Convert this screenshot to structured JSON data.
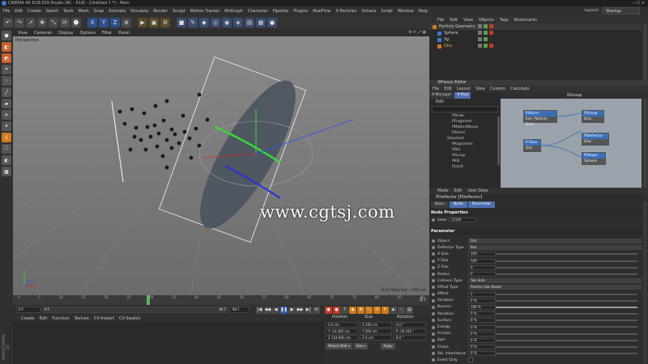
{
  "window": {
    "title": "CINEMA 4D R18.039 Studio (RC - R18) - [Untitled 1 *] - Main",
    "controls": "─ ☐ ✕"
  },
  "menubar": {
    "items": [
      "File",
      "Edit",
      "Create",
      "Select",
      "Tools",
      "Mesh",
      "Snap",
      "Animate",
      "Simulate",
      "Render",
      "Sculpt",
      "Motion Tracker",
      "MoGraph",
      "Character",
      "Pipeline",
      "Plugins",
      "RealFlow",
      "X-Particles",
      "Octane",
      "Script",
      "Window",
      "Help"
    ],
    "layout_label": "Layout:",
    "layout_value": "Startup"
  },
  "toolbar": {
    "icons": [
      "undo-icon",
      "redo-icon",
      "select-icon",
      "move-icon",
      "scale-icon",
      "rotate-icon",
      "recent-icon",
      "x-axis-icon",
      "y-axis-icon",
      "z-axis-icon",
      "coord-icon",
      "render-view-icon",
      "render-pv-icon",
      "render-settings-icon",
      "cube-icon",
      "pen-icon",
      "subdivision-icon",
      "array-icon",
      "nurbs-icon",
      "deformer-icon",
      "scene-icon",
      "camera-icon",
      "light-icon"
    ],
    "glyphs": [
      "↶",
      "↷",
      "➚",
      "✥",
      "⤡",
      "⟳",
      "⌚",
      "X",
      "Y",
      "Z",
      "⊕",
      "▶",
      "▣",
      "⚙",
      "■",
      "✎",
      "◆",
      "◎",
      "◉",
      "◈",
      "▤",
      "▦",
      "●"
    ]
  },
  "left_tools": {
    "icons": [
      "make-editable-icon",
      "model-mode-icon",
      "texture-mode-icon",
      "workplane-icon",
      "points-mode-icon",
      "edges-mode-icon",
      "polygons-mode-icon",
      "axis-mode-icon",
      "tweak-icon",
      "snap-icon",
      "locked-workplane-icon",
      "soft-select-icon",
      "quantize-icon"
    ],
    "glyphs": [
      "⬢",
      "◧",
      "◩",
      "⌗",
      "⁘",
      "╱",
      "▰",
      "✛",
      "⚹",
      "S",
      "⛶",
      "◐",
      "▩"
    ]
  },
  "viewport": {
    "menu": [
      "View",
      "Cameras",
      "Display",
      "Options",
      "Filter",
      "Panel"
    ],
    "view_icons": "✥ ⟳ ⤢ ▣",
    "label": "Perspective",
    "grid_spacing": "Grid Spacing : 100 cm",
    "watermark": "www.cgtsj.com"
  },
  "timeline": {
    "ticks": [
      "0",
      "5",
      "10",
      "15",
      "20",
      "25",
      "30",
      "35",
      "40",
      "45",
      "50",
      "55",
      "60",
      "65",
      "70",
      "75",
      "80",
      "85",
      "90"
    ],
    "end_frame": "32 F"
  },
  "transport": {
    "start": "0 F",
    "current": "0 F",
    "slider_value": "90 F",
    "end": "90 F",
    "buttons": [
      "|◀",
      "◀◀",
      "◀",
      "❚❚",
      "▶",
      "▶▶",
      "▶|",
      "⟲"
    ],
    "key_buttons": [
      "●",
      "●",
      "?",
      "◆",
      "✥",
      "⤡",
      "⟳",
      "P",
      "◈",
      "⁘",
      "▤"
    ]
  },
  "material_manager": {
    "menu": [
      "Create",
      "Edit",
      "Function",
      "Texture",
      "CV-Import",
      "CV-Swatch"
    ],
    "brand": "MAXON CINEMA 4D"
  },
  "coordinates": {
    "headers": [
      "Position",
      "Size",
      "Rotation"
    ],
    "rows": [
      [
        "X  0 cm",
        "X  200 cm",
        "H  0 °"
      ],
      [
        "Y  -12.405 cm",
        "Y  200 cm",
        "P  -36.192 °"
      ],
      [
        "Z  154.683 cm",
        "Z  0 cm",
        "B  0 °"
      ]
    ],
    "mode": "Object (Rel) ▾",
    "size_mode": "Size ▾",
    "apply": "Apply"
  },
  "object_manager": {
    "menu": [
      "File",
      "Edit",
      "View",
      "Objects",
      "Tags",
      "Bookmarks"
    ],
    "objects": [
      {
        "name": "Particle Geometry",
        "icon": "orange"
      },
      {
        "name": "Sphere",
        "icon": "blue"
      },
      {
        "name": "Xp",
        "icon": "blue"
      },
      {
        "name": "Disc",
        "icon": "orange"
      }
    ]
  },
  "xpresso": {
    "title": "XPresso Editor",
    "menu": [
      "File",
      "Edit",
      "Layout",
      "View",
      "Custom",
      "Calculate"
    ],
    "tabs": [
      "X-Manager",
      "X-Pool"
    ],
    "edit": "Edit",
    "tree": [
      "PDraw",
      "PFragment",
      "PMatterWaves",
      "PStorm",
      "Standard",
      "PAlignment",
      "PDie",
      "PGroup",
      "PKill",
      "PLimit"
    ],
    "graph_title": "XGroup",
    "nodes": [
      {
        "title": "PStorm",
        "port": "Ext. Particle Birth"
      },
      {
        "title": "PGroup",
        "port": "Disc"
      },
      {
        "title": "P Pass",
        "port": "Out"
      },
      {
        "title": "PDeflector",
        "port": "Disc"
      },
      {
        "title": "PShape",
        "port": "Sphere"
      }
    ]
  },
  "attributes": {
    "menu": [
      "Mode",
      "Edit",
      "User Data"
    ],
    "title": "PDeflector [PDeflector]",
    "tabs": [
      "Basic",
      "Node",
      "Parameter"
    ],
    "node_props_header": "Node Properties",
    "seed_label": "Seed",
    "seed_value": "12345",
    "parameter_header": "Parameter",
    "rows": [
      {
        "label": "Object",
        "value": "Disc",
        "type": "wide"
      },
      {
        "label": "Deflector Type",
        "value": "Box",
        "type": "wide"
      },
      {
        "label": "X Size",
        "value": "100",
        "type": "num",
        "fill": 0.0
      },
      {
        "label": "Y Size",
        "value": "100",
        "type": "num",
        "fill": 0.0
      },
      {
        "label": "Z Size",
        "value": "0",
        "type": "num",
        "fill": 0.0
      },
      {
        "label": "Radius",
        "value": "0",
        "type": "num",
        "fill": 0.0
      },
      {
        "label": "Collision Type",
        "value": "Two Side",
        "type": "wide"
      },
      {
        "label": "Offset Type",
        "value": "Particle Size Based",
        "type": "wide"
      },
      {
        "label": "Offset",
        "value": "2",
        "type": "num",
        "fill": 0.0
      },
      {
        "label": "Variation",
        "value": "0 %",
        "type": "num",
        "fill": 0.0
      },
      {
        "label": "Bounce",
        "value": "100 %",
        "type": "num",
        "fill": 1.0
      },
      {
        "label": "Variation",
        "value": "0 %",
        "type": "num",
        "fill": 0.0
      },
      {
        "label": "Surface",
        "value": "0 %",
        "type": "num",
        "fill": 0.0
      },
      {
        "label": "Energy",
        "value": "0 %",
        "type": "num",
        "fill": 0.0
      },
      {
        "label": "Friction",
        "value": "0 %",
        "type": "num",
        "fill": 0.0
      },
      {
        "label": "Spin",
        "value": "0 %",
        "type": "num",
        "fill": 0.0
      },
      {
        "label": "Chaos",
        "value": "0 %",
        "type": "num",
        "fill": 0.0
      },
      {
        "label": "Vel. Inheritance",
        "value": "0 %",
        "type": "num",
        "fill": 0.0
      },
      {
        "label": "Event Only",
        "value": "",
        "type": "check"
      }
    ]
  }
}
